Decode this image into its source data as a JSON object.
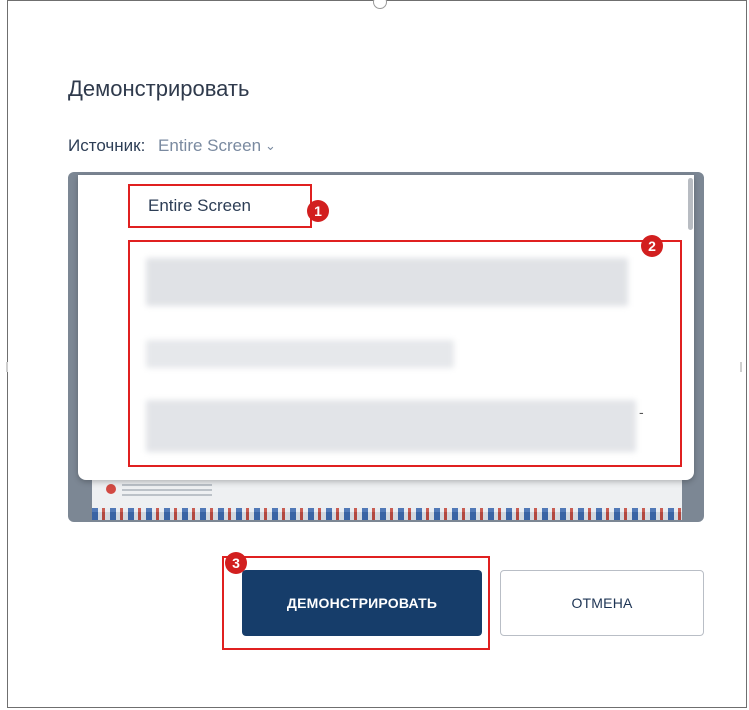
{
  "dialog": {
    "title": "Демонстрировать",
    "source_label": "Источник:",
    "source_value": "Entire Screen"
  },
  "source_dropdown": {
    "options": [
      {
        "label": "Entire Screen"
      }
    ],
    "chevron_icon": "chevron-down-icon"
  },
  "callouts": [
    {
      "number": "1"
    },
    {
      "number": "2"
    },
    {
      "number": "3"
    }
  ],
  "buttons": {
    "share_label": "ДЕМОНСТРИРОВАТЬ",
    "cancel_label": "ОТМЕНА"
  },
  "colors": {
    "primary": "#163d6a",
    "callout": "#e02020"
  }
}
